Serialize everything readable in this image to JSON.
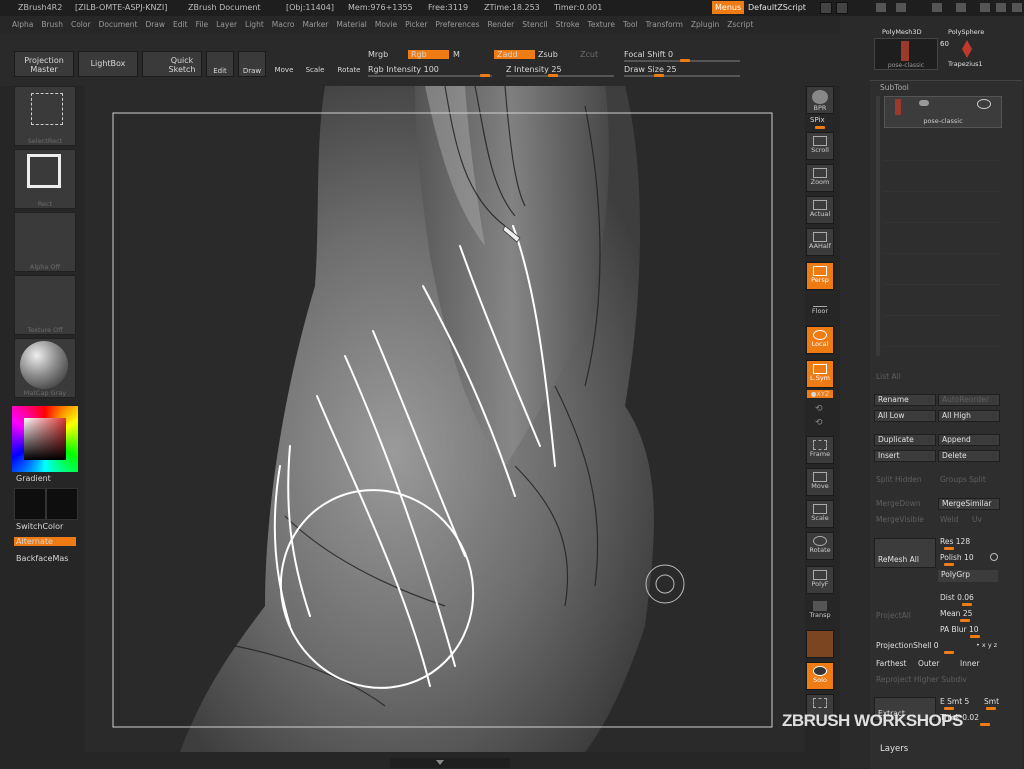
{
  "titlebar": {
    "app": "ZBrush4R2",
    "code": "[ZILB-OMTE-ASPJ-KNZI]",
    "doc": "ZBrush Document",
    "obj": "[Obj:11404]",
    "mem": "Mem:976+1355",
    "free": "Free:3119",
    "ztime": "ZTime:18.253",
    "timer": "Timer:0.001",
    "menus": "Menus",
    "script": "DefaultZScript"
  },
  "menubar": [
    "Alpha",
    "Brush",
    "Color",
    "Document",
    "Draw",
    "Edit",
    "File",
    "Layer",
    "Light",
    "Macro",
    "Marker",
    "Material",
    "Movie",
    "Picker",
    "Preferences",
    "Render",
    "Stencil",
    "Stroke",
    "Texture",
    "Tool",
    "Transform",
    "Zplugin",
    "Zscript"
  ],
  "toolbar": {
    "projection_master": "Projection Master",
    "lightbox": "LightBox",
    "quick_sketch": "Quick Sketch",
    "edit": "Edit",
    "draw": "Draw",
    "move": "Move",
    "scale": "Scale",
    "rotate": "Rotate",
    "mrgb": "Mrgb",
    "rgb": "Rgb",
    "m": "M",
    "rgb_intensity": "Rgb  Intensity 100",
    "zadd": "Zadd",
    "zsub": "Zsub",
    "zcut": "Zcut",
    "z_intensity": "Z  Intensity 25",
    "focal_shift": "Focal  Shift 0",
    "draw_size": "Draw  Size 25"
  },
  "left_panel": {
    "select_rect": "SelectRect",
    "rect": "Rect",
    "alpha_off": "Alpha  Off",
    "texture_off": "Texture  Off",
    "matcap": "MatCap  Gray",
    "gradient": "Gradient",
    "switch_color": "SwitchColor",
    "alternate": "Alternate",
    "backface": "BackfaceMas"
  },
  "right_toolbar": {
    "bpr": "BPR",
    "spix": "SPix",
    "scroll": "Scroll",
    "zoom": "Zoom",
    "actual": "Actual",
    "aahalf": "AAHalf",
    "persp": "Persp",
    "floor": "Floor",
    "local": "Local",
    "lsym": "L.Sym",
    "xyz": "●XYZ",
    "frame": "Frame",
    "move": "Move",
    "scale": "Scale",
    "rotate": "Rotate",
    "polyf": "PolyF",
    "transp": "Transp",
    "solo": "Solo"
  },
  "tool_palette": {
    "polymesh": "PolyMesh3D",
    "polysphere": "PolySphere",
    "pose_classic": "pose-classic",
    "count": "60",
    "trapezius": "Trapezius1"
  },
  "subtool": {
    "header": "SubTool",
    "item_name": "pose-classic",
    "list_all": "List  All",
    "rename": "Rename",
    "auto_reorder": "AutoReorder",
    "all_low": "All  Low",
    "all_high": "All  High",
    "duplicate": "Duplicate",
    "append": "Append",
    "insert": "Insert",
    "delete": "Delete",
    "split_hidden": "Split  Hidden",
    "groups_split": "Groups  Split",
    "merge_down": "MergeDown",
    "merge_similar": "MergeSimilar",
    "merge_visible": "MergeVisible",
    "weld": "Weld",
    "uv": "Uv",
    "remesh_all": "ReMesh  All",
    "res": "Res 128",
    "polish": "Polish 10",
    "polygrp": "PolyGrp",
    "project_all": "ProjectAll",
    "dist": "Dist 0.06",
    "mean": "Mean 25",
    "pa_blur": "PA  Blur 10",
    "projection_shell": "ProjectionShell 0",
    "xyz": "• x y z",
    "farthest": "Farthest",
    "outer": "Outer",
    "inner": "Inner",
    "reproject": "Reproject  Higher  Subdiv",
    "extract": "Extract",
    "e_smt": "E  Smt  5",
    "s_smt": "Smt",
    "thick": "Thick 0.02",
    "layers": "Layers"
  },
  "watermark": "ZBRUSH WORKSHOPS",
  "colors": {
    "accent": "#ef7b14",
    "panel": "#3a3a3a",
    "bg": "#262626"
  }
}
